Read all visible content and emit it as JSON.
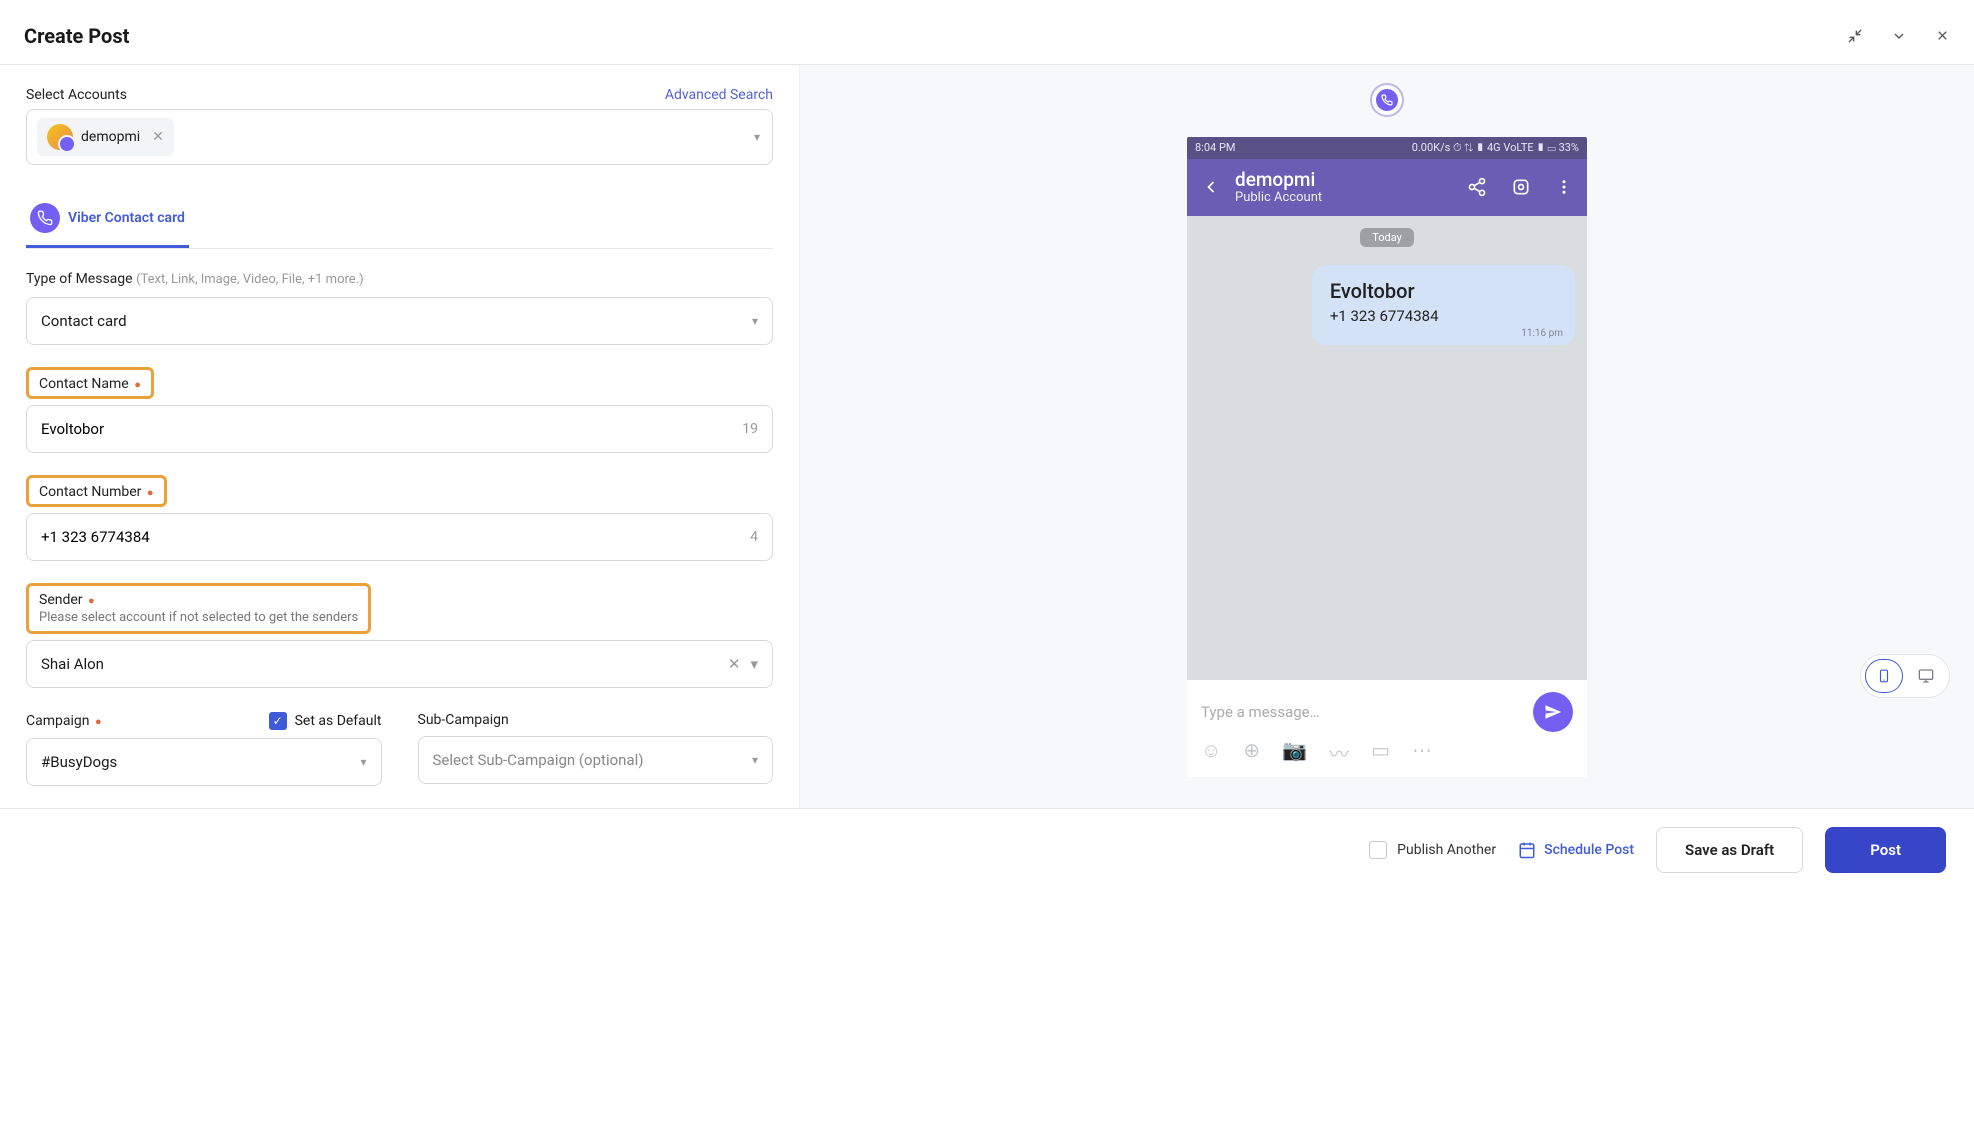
{
  "header": {
    "title": "Create Post"
  },
  "accounts": {
    "label": "Select Accounts",
    "advanced": "Advanced Search",
    "chip": "demopmi"
  },
  "tab": {
    "label": "Viber Contact card"
  },
  "type_of_message": {
    "label": "Type of Message",
    "hint": "(Text, Link, Image, Video, File, +1 more.)",
    "value": "Contact card"
  },
  "contact_name": {
    "label": "Contact Name",
    "value": "Evoltobor",
    "count": "19"
  },
  "contact_number": {
    "label": "Contact Number",
    "value": "+1 323 6774384",
    "count": "4"
  },
  "sender": {
    "label": "Sender",
    "help": "Please select account if not selected to get the senders",
    "value": "Shai Alon"
  },
  "campaign": {
    "label": "Campaign",
    "set_default": "Set as Default",
    "value": "#BusyDogs"
  },
  "subcampaign": {
    "label": "Sub-Campaign",
    "placeholder": "Select Sub-Campaign (optional)"
  },
  "preview": {
    "statusbar_left": "8:04 PM",
    "statusbar_right": "0.00K/s ⏱ ⇅ ▮ 4G VoLTE ▮ ▭ 33%",
    "account_name": "demopmi",
    "account_type": "Public Account",
    "day": "Today",
    "bubble_name": "Evoltobor",
    "bubble_number": "+1 323 6774384",
    "bubble_time": "11:16 pm",
    "compose_placeholder": "Type a message…"
  },
  "footer": {
    "publish_another": "Publish Another",
    "schedule": "Schedule Post",
    "save_draft": "Save as Draft",
    "post": "Post"
  }
}
